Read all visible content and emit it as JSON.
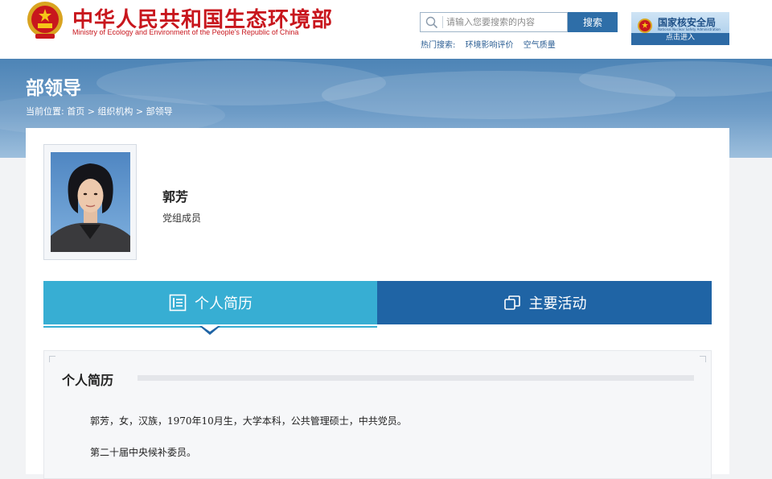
{
  "header": {
    "title": "中华人民共和国生态环境部",
    "subtitle": "Ministry of Ecology and Environment of the People's Republic of China",
    "search": {
      "placeholder": "请输入您要搜索的内容",
      "button_label": "搜索"
    },
    "hot_search": {
      "label": "热门搜索:",
      "links": [
        "环境影响评价",
        "空气质量"
      ]
    },
    "nnsa": {
      "title": "国家核安全局",
      "english": "National Nuclear Safety Administration",
      "enter_label": "点击进入"
    }
  },
  "banner": {
    "heading": "部领导",
    "breadcrumb": "当前位置: 首页 > 组织机构 > 部领导"
  },
  "profile": {
    "name": "郭芳",
    "title": "党组成员"
  },
  "tabs": [
    {
      "label": "个人简历",
      "icon": "document-list-icon",
      "active": true
    },
    {
      "label": "主要活动",
      "icon": "copy-pages-icon",
      "active": false
    }
  ],
  "resume": {
    "heading": "个人简历",
    "lines": [
      "郭芳，女，汉族，1970年10月生，大学本科，公共管理硕士，中共党员。",
      "第二十届中央候补委员。"
    ]
  },
  "colors": {
    "brand_red": "#c8161d",
    "primary_blue": "#1f64a5",
    "tab_cyan": "#37aed3",
    "banner_blue": "#4d84b6"
  }
}
